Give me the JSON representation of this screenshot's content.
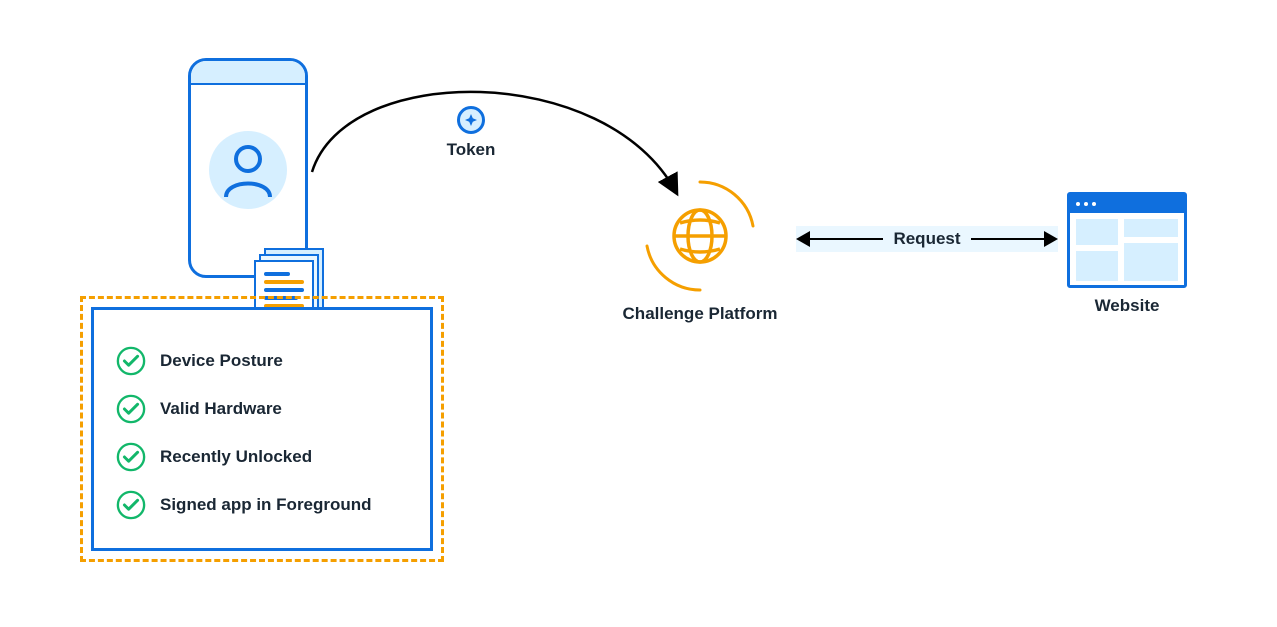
{
  "colors": {
    "blue": "#0f6fde",
    "light_blue": "#d6efff",
    "orange": "#f59f00",
    "green": "#12b76a",
    "text": "#1a2734"
  },
  "token": {
    "label": "Token"
  },
  "challenge": {
    "label": "Challenge Platform"
  },
  "website": {
    "label": "Website"
  },
  "request": {
    "label": "Request"
  },
  "checklist": {
    "items": [
      {
        "label": "Device Posture"
      },
      {
        "label": "Valid Hardware"
      },
      {
        "label": "Recently Unlocked"
      },
      {
        "label": "Signed app in Foreground"
      }
    ]
  }
}
